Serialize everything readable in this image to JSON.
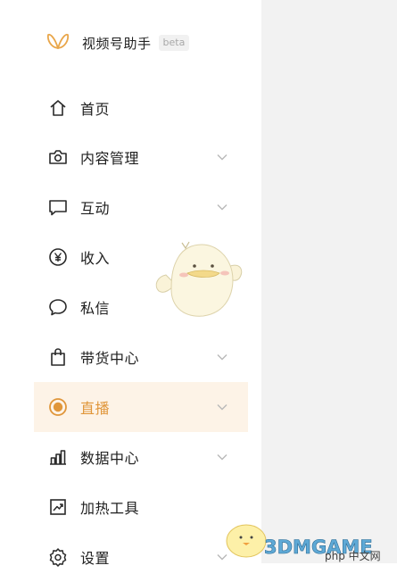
{
  "brand": {
    "title": "视频号助手",
    "badge": "beta"
  },
  "nav": {
    "items": [
      {
        "label": "首页",
        "icon": "home-icon"
      },
      {
        "label": "内容管理",
        "icon": "camera-icon"
      },
      {
        "label": "互动",
        "icon": "message-square-icon"
      },
      {
        "label": "收入",
        "icon": "yen-circle-icon"
      },
      {
        "label": "私信",
        "icon": "chat-bubble-icon"
      },
      {
        "label": "带货中心",
        "icon": "shopping-bag-icon"
      },
      {
        "label": "直播",
        "icon": "live-record-icon",
        "active": true
      },
      {
        "label": "数据中心",
        "icon": "bar-chart-icon"
      },
      {
        "label": "加热工具",
        "icon": "trend-chart-icon"
      },
      {
        "label": "设置",
        "icon": "gear-icon"
      }
    ]
  },
  "watermark": {
    "main": "3DMGAME",
    "site": "php 中文网"
  },
  "colors": {
    "accent": "#e0963a",
    "active_bg": "#fdf3e7",
    "panel_bg": "#f2f2f2",
    "icon": "#2a2a2a",
    "chevron": "#b8b8b8"
  }
}
